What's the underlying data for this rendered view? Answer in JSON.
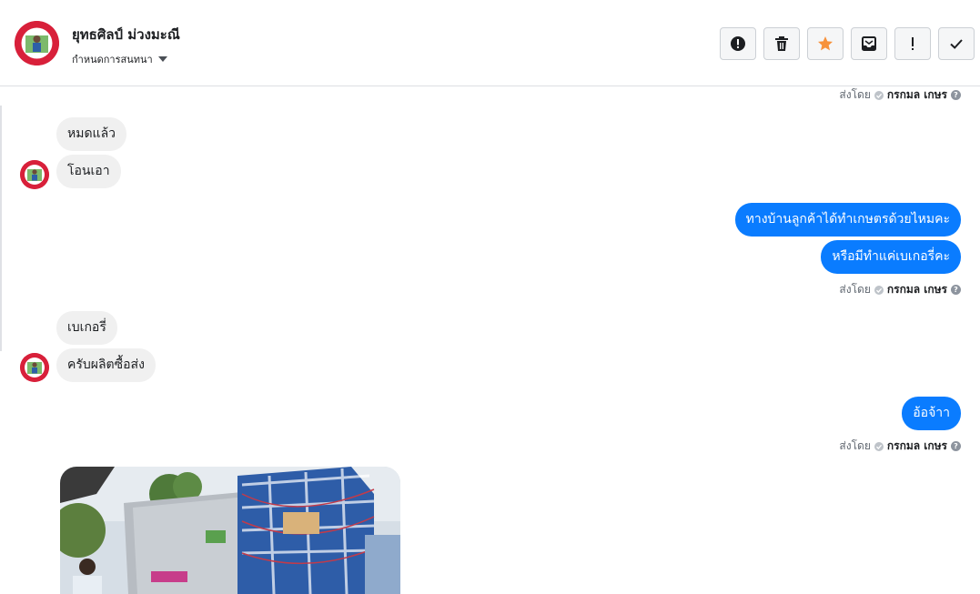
{
  "header": {
    "contact_name": "ยุทธศิลป์ ม่วงมะณี",
    "conversation_settings": "กำหนดการสนทนา",
    "tools": [
      {
        "icon": "spam-icon"
      },
      {
        "icon": "trash-icon"
      },
      {
        "icon": "star-icon"
      },
      {
        "icon": "archive-icon"
      },
      {
        "icon": "exclamation-icon"
      },
      {
        "icon": "check-icon"
      }
    ]
  },
  "sent_by": {
    "prefix": "ส่งโดย",
    "name": "กรกมล เกษร",
    "help": "?"
  },
  "messages": {
    "in_1": "หมดแล้ว",
    "in_2": "โอนเอา",
    "out_1": "ทางบ้านลูกค้าได้ทำเกษตรด้วยไหมคะ",
    "out_2": "หรือมีทำแค่เบเกอรี่คะ",
    "in_3": "เบเกอรี่",
    "in_4": "ครับผลิตซื้อส่ง",
    "out_3": "อ้อจ้าา"
  },
  "colors": {
    "outgoing_bubble": "#0a7cff",
    "incoming_bubble": "#f0f0f0",
    "star": "#f7923b"
  }
}
